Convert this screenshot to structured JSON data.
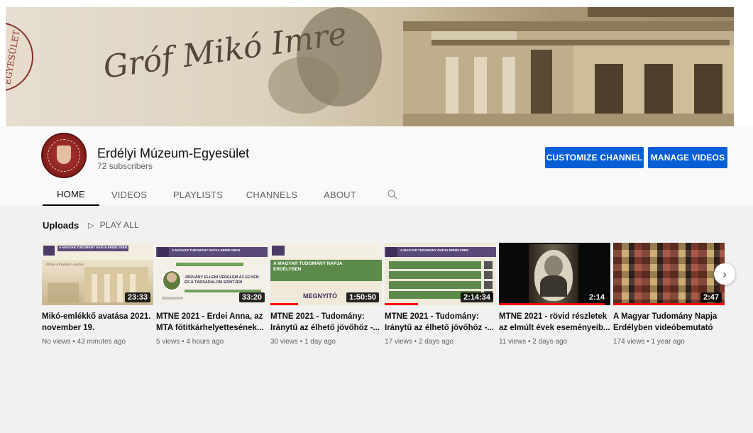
{
  "banner": {
    "signature_text": "Gróf Mikó Imre",
    "seal_text": "EGYESÜLET"
  },
  "channel": {
    "name": "Erdélyi Múzeum-Egyesület",
    "subscribers": "72 subscribers",
    "avatar_text": "ERDÉLYI MÚZEUM EGYESÜLET"
  },
  "actions": {
    "customize_label": "CUSTOMIZE CHANNEL",
    "manage_label": "MANAGE VIDEOS"
  },
  "tabs": [
    {
      "label": "HOME"
    },
    {
      "label": "VIDEOS"
    },
    {
      "label": "PLAYLISTS"
    },
    {
      "label": "CHANNELS"
    },
    {
      "label": "ABOUT"
    }
  ],
  "uploads": {
    "title": "Uploads",
    "play_all_label": "PLAY ALL"
  },
  "videos": [
    {
      "title": "Mikó-emlékkő avatása 2021. november 19.",
      "meta": "No views • 43 minutes ago",
      "duration": "23:33",
      "thumb_heading": "A MAGYAR TUDOMÁNY NAPJA ERDÉLYBEN",
      "thumb_sub": "Mikó-emlékkő avatás",
      "progress": 0
    },
    {
      "title": "MTNE 2021 - Erdei Anna, az MTA főtitkárhelyettesének...",
      "meta": "5 views • 4 hours ago",
      "duration": "33:20",
      "thumb_heading": "A MAGYAR TUDOMÁNY NAPJA ERDÉLYBEN",
      "thumb_sub": "JÁRVÁNY ELLENI VÉDELEM AZ EGYÉN ÉS A TÁRSADALOM SZINTJÉN",
      "progress": 0
    },
    {
      "title": "MTNE 2021 - Tudomány: Iránytű az élhető jövőhöz -...",
      "meta": "30 views • 1 day ago",
      "duration": "1:50:50",
      "thumb_heading": "A MAGYAR TUDOMÁNY NAPJA ERDÉLYBEN",
      "thumb_sub": "MEGNYITÓ",
      "progress": 0.25
    },
    {
      "title": "MTNE 2021 - Tudomány: Iránytű az élhető jövőhöz -...",
      "meta": "17 views • 2 days ago",
      "duration": "2:14:34",
      "thumb_heading": "A MAGYAR TUDOMÁNY NAPJA ERDÉLYBEN",
      "thumb_sub": "",
      "progress": 0.3
    },
    {
      "title": "MTNE 2021 - rövid részletek az elmúlt évek eseményeib...",
      "meta": "11 views • 2 days ago",
      "duration": "2:14",
      "thumb_heading": "",
      "thumb_sub": "",
      "progress": 0.95
    },
    {
      "title": "A Magyar Tudomány Napja Erdélyben videóbemutató",
      "meta": "174 views • 1 year ago",
      "duration": "2:47",
      "thumb_heading": "",
      "thumb_sub": "",
      "progress": 1.0
    }
  ],
  "colors": {
    "accent": "#065fd4",
    "progress": "#ff0000",
    "thumb_purple": "#5a4a7a",
    "thumb_green": "#5c8a4a"
  },
  "icons": {
    "search": "search-icon",
    "play_all": "play-icon",
    "next": "chevron-right-icon"
  }
}
